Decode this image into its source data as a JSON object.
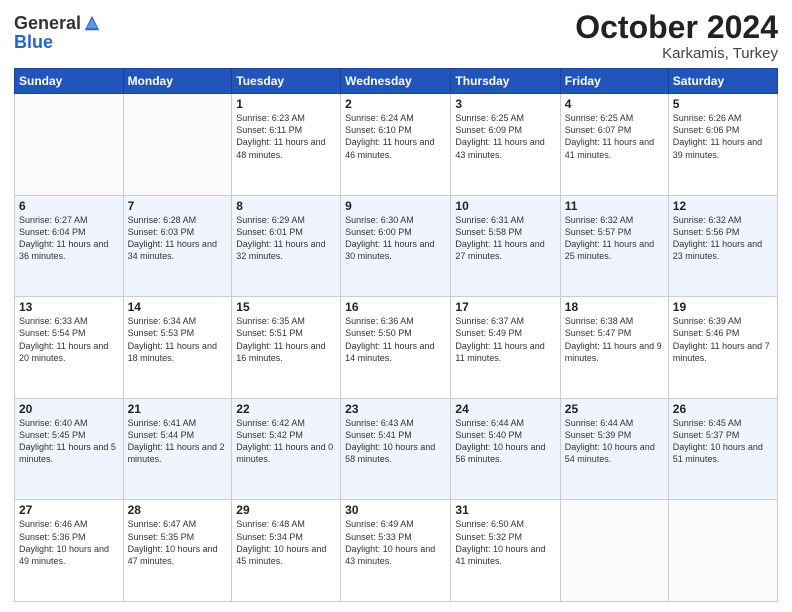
{
  "header": {
    "logo_general": "General",
    "logo_blue": "Blue",
    "month_title": "October 2024",
    "subtitle": "Karkamis, Turkey"
  },
  "days_of_week": [
    "Sunday",
    "Monday",
    "Tuesday",
    "Wednesday",
    "Thursday",
    "Friday",
    "Saturday"
  ],
  "weeks": [
    [
      {
        "day": "",
        "info": ""
      },
      {
        "day": "",
        "info": ""
      },
      {
        "day": "1",
        "info": "Sunrise: 6:23 AM\nSunset: 6:11 PM\nDaylight: 11 hours and 48 minutes."
      },
      {
        "day": "2",
        "info": "Sunrise: 6:24 AM\nSunset: 6:10 PM\nDaylight: 11 hours and 46 minutes."
      },
      {
        "day": "3",
        "info": "Sunrise: 6:25 AM\nSunset: 6:09 PM\nDaylight: 11 hours and 43 minutes."
      },
      {
        "day": "4",
        "info": "Sunrise: 6:25 AM\nSunset: 6:07 PM\nDaylight: 11 hours and 41 minutes."
      },
      {
        "day": "5",
        "info": "Sunrise: 6:26 AM\nSunset: 6:06 PM\nDaylight: 11 hours and 39 minutes."
      }
    ],
    [
      {
        "day": "6",
        "info": "Sunrise: 6:27 AM\nSunset: 6:04 PM\nDaylight: 11 hours and 36 minutes."
      },
      {
        "day": "7",
        "info": "Sunrise: 6:28 AM\nSunset: 6:03 PM\nDaylight: 11 hours and 34 minutes."
      },
      {
        "day": "8",
        "info": "Sunrise: 6:29 AM\nSunset: 6:01 PM\nDaylight: 11 hours and 32 minutes."
      },
      {
        "day": "9",
        "info": "Sunrise: 6:30 AM\nSunset: 6:00 PM\nDaylight: 11 hours and 30 minutes."
      },
      {
        "day": "10",
        "info": "Sunrise: 6:31 AM\nSunset: 5:58 PM\nDaylight: 11 hours and 27 minutes."
      },
      {
        "day": "11",
        "info": "Sunrise: 6:32 AM\nSunset: 5:57 PM\nDaylight: 11 hours and 25 minutes."
      },
      {
        "day": "12",
        "info": "Sunrise: 6:32 AM\nSunset: 5:56 PM\nDaylight: 11 hours and 23 minutes."
      }
    ],
    [
      {
        "day": "13",
        "info": "Sunrise: 6:33 AM\nSunset: 5:54 PM\nDaylight: 11 hours and 20 minutes."
      },
      {
        "day": "14",
        "info": "Sunrise: 6:34 AM\nSunset: 5:53 PM\nDaylight: 11 hours and 18 minutes."
      },
      {
        "day": "15",
        "info": "Sunrise: 6:35 AM\nSunset: 5:51 PM\nDaylight: 11 hours and 16 minutes."
      },
      {
        "day": "16",
        "info": "Sunrise: 6:36 AM\nSunset: 5:50 PM\nDaylight: 11 hours and 14 minutes."
      },
      {
        "day": "17",
        "info": "Sunrise: 6:37 AM\nSunset: 5:49 PM\nDaylight: 11 hours and 11 minutes."
      },
      {
        "day": "18",
        "info": "Sunrise: 6:38 AM\nSunset: 5:47 PM\nDaylight: 11 hours and 9 minutes."
      },
      {
        "day": "19",
        "info": "Sunrise: 6:39 AM\nSunset: 5:46 PM\nDaylight: 11 hours and 7 minutes."
      }
    ],
    [
      {
        "day": "20",
        "info": "Sunrise: 6:40 AM\nSunset: 5:45 PM\nDaylight: 11 hours and 5 minutes."
      },
      {
        "day": "21",
        "info": "Sunrise: 6:41 AM\nSunset: 5:44 PM\nDaylight: 11 hours and 2 minutes."
      },
      {
        "day": "22",
        "info": "Sunrise: 6:42 AM\nSunset: 5:42 PM\nDaylight: 11 hours and 0 minutes."
      },
      {
        "day": "23",
        "info": "Sunrise: 6:43 AM\nSunset: 5:41 PM\nDaylight: 10 hours and 58 minutes."
      },
      {
        "day": "24",
        "info": "Sunrise: 6:44 AM\nSunset: 5:40 PM\nDaylight: 10 hours and 56 minutes."
      },
      {
        "day": "25",
        "info": "Sunrise: 6:44 AM\nSunset: 5:39 PM\nDaylight: 10 hours and 54 minutes."
      },
      {
        "day": "26",
        "info": "Sunrise: 6:45 AM\nSunset: 5:37 PM\nDaylight: 10 hours and 51 minutes."
      }
    ],
    [
      {
        "day": "27",
        "info": "Sunrise: 6:46 AM\nSunset: 5:36 PM\nDaylight: 10 hours and 49 minutes."
      },
      {
        "day": "28",
        "info": "Sunrise: 6:47 AM\nSunset: 5:35 PM\nDaylight: 10 hours and 47 minutes."
      },
      {
        "day": "29",
        "info": "Sunrise: 6:48 AM\nSunset: 5:34 PM\nDaylight: 10 hours and 45 minutes."
      },
      {
        "day": "30",
        "info": "Sunrise: 6:49 AM\nSunset: 5:33 PM\nDaylight: 10 hours and 43 minutes."
      },
      {
        "day": "31",
        "info": "Sunrise: 6:50 AM\nSunset: 5:32 PM\nDaylight: 10 hours and 41 minutes."
      },
      {
        "day": "",
        "info": ""
      },
      {
        "day": "",
        "info": ""
      }
    ]
  ]
}
